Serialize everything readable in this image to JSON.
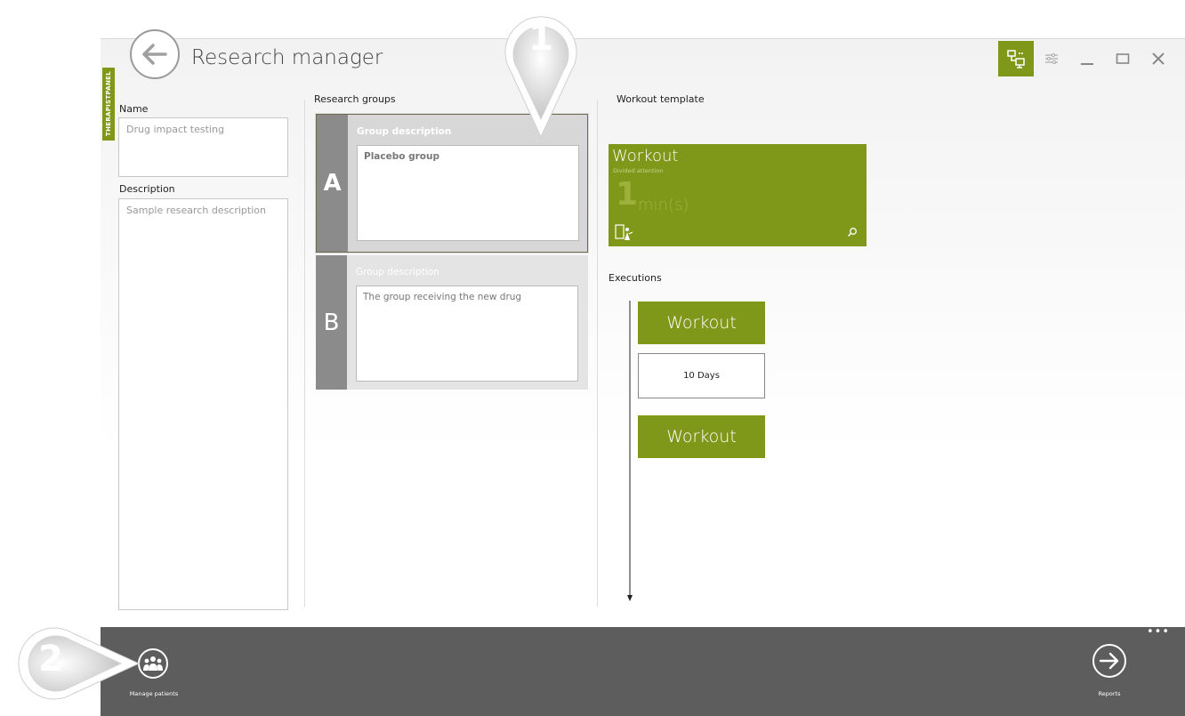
{
  "header": {
    "title": "Research manager",
    "therapist_tab": "THERAPISTPANEL"
  },
  "left_panel": {
    "name_label": "Name",
    "name_value": "Drug impact testing",
    "description_label": "Description",
    "description_value": "Sample research description"
  },
  "groups": {
    "heading": "Research groups",
    "items": [
      {
        "letter": "A",
        "desc_label": "Group description",
        "desc_value": "Placebo group"
      },
      {
        "letter": "B",
        "desc_label": "Group description",
        "desc_value": "The group receiving the new drug"
      }
    ]
  },
  "template": {
    "heading": "Workout template",
    "tile_title": "Workout",
    "tile_subtitle": "Divided attention",
    "duration_value": "1",
    "duration_unit": "min(s)"
  },
  "executions": {
    "heading": "Executions",
    "block1": "Workout",
    "interval": "10 Days",
    "block2": "Workout"
  },
  "callouts": {
    "marker1": "1",
    "marker2": "2"
  },
  "bottom_bar": {
    "manage_patients_label": "Manage patients",
    "reports_label": "Reports",
    "more": "•••"
  },
  "colors": {
    "accent": "#7f9819",
    "bar": "#5d5d5d"
  }
}
